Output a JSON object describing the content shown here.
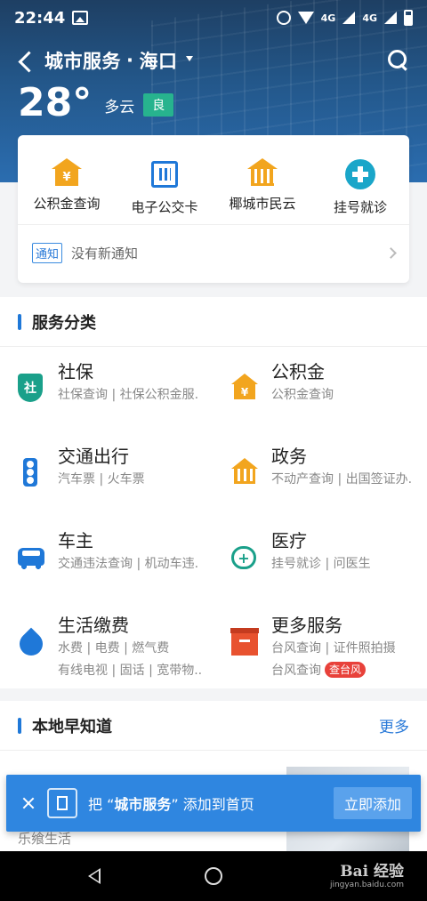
{
  "status_bar": {
    "time": "22:44",
    "net1": "4G",
    "net2": "4G"
  },
  "header": {
    "title": "城市服务",
    "separator": "·",
    "city": "海口"
  },
  "weather": {
    "temp": "28°",
    "condition": "多云",
    "aqi": "良"
  },
  "quick": [
    {
      "label": "公积金查询",
      "icon": "housing-fund-icon"
    },
    {
      "label": "电子公交卡",
      "icon": "bus-card-qr-icon"
    },
    {
      "label": "椰城市民云",
      "icon": "government-building-icon"
    },
    {
      "label": "挂号就诊",
      "icon": "medical-cross-icon"
    }
  ],
  "notice": {
    "tag": "通知",
    "text": "没有新通知"
  },
  "services_section": {
    "title": "服务分类"
  },
  "services": [
    {
      "name": "社保",
      "desc": "社保查询 | 社保公积金服.",
      "icon": "social-security-shield-icon",
      "icon_text": "社"
    },
    {
      "name": "公积金",
      "desc": "公积金查询",
      "icon": "housing-fund-icon",
      "icon_text": "¥"
    },
    {
      "name": "交通出行",
      "desc": "汽车票 | 火车票",
      "icon": "traffic-light-icon"
    },
    {
      "name": "政务",
      "desc": "不动产查询 | 出国签证办.",
      "icon": "government-building-icon"
    },
    {
      "name": "车主",
      "desc": "交通违法查询 | 机动车违.",
      "icon": "car-icon"
    },
    {
      "name": "医疗",
      "desc": "挂号就诊 | 问医生",
      "icon": "medical-heart-icon",
      "icon_text": "+"
    },
    {
      "name": "生活缴费",
      "desc": "水费 | 电费 | 燃气费",
      "desc2": "有线电视 | 固话 | 宽带物..",
      "icon": "water-drop-icon"
    },
    {
      "name": "更多服务",
      "desc": "台风查询 | 证件照拍摄",
      "desc2": "台风查询",
      "badge": "查台风",
      "icon": "more-box-icon"
    }
  ],
  "local_section": {
    "title": "本地早知道",
    "more": "更多"
  },
  "news": {
    "source": "乐飨生活"
  },
  "toast": {
    "prefix": "把 “",
    "app": "城市服务",
    "suffix": "” 添加到首页",
    "button": "立即添加"
  },
  "watermark": {
    "brand": "Bai 经验",
    "url": "jingyan.baidu.com"
  },
  "colors": {
    "accent": "#1f78d8",
    "green": "#27b38e",
    "orange": "#f2a51e",
    "red": "#e8413a"
  }
}
